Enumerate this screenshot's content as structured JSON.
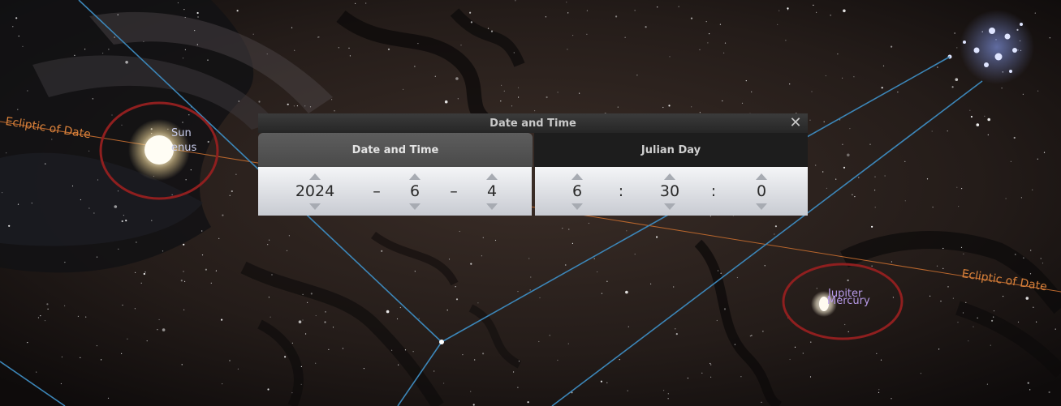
{
  "sky": {
    "ecliptic_left": "Ecliptic of Date",
    "ecliptic_right": "Ecliptic of Date",
    "sun_label": "Sun",
    "venus_label": "enus",
    "jupiter_label": "Jupiter",
    "mercury_label": "Mercury",
    "colors": {
      "ecliptic": "#d8803a",
      "constellation_lines": "#3c86b8",
      "highlight_circle": "#8f1f1f"
    }
  },
  "dialog": {
    "title": "Date and Time",
    "close_icon": "close-icon",
    "tabs": [
      {
        "label": "Date and Time",
        "active": true
      },
      {
        "label": "Julian Day",
        "active": false
      }
    ],
    "date": {
      "year": "2024",
      "month": "6",
      "day": "4",
      "separator": "–"
    },
    "time": {
      "hour": "6",
      "minute": "30",
      "second": "0",
      "separator": ":"
    }
  }
}
